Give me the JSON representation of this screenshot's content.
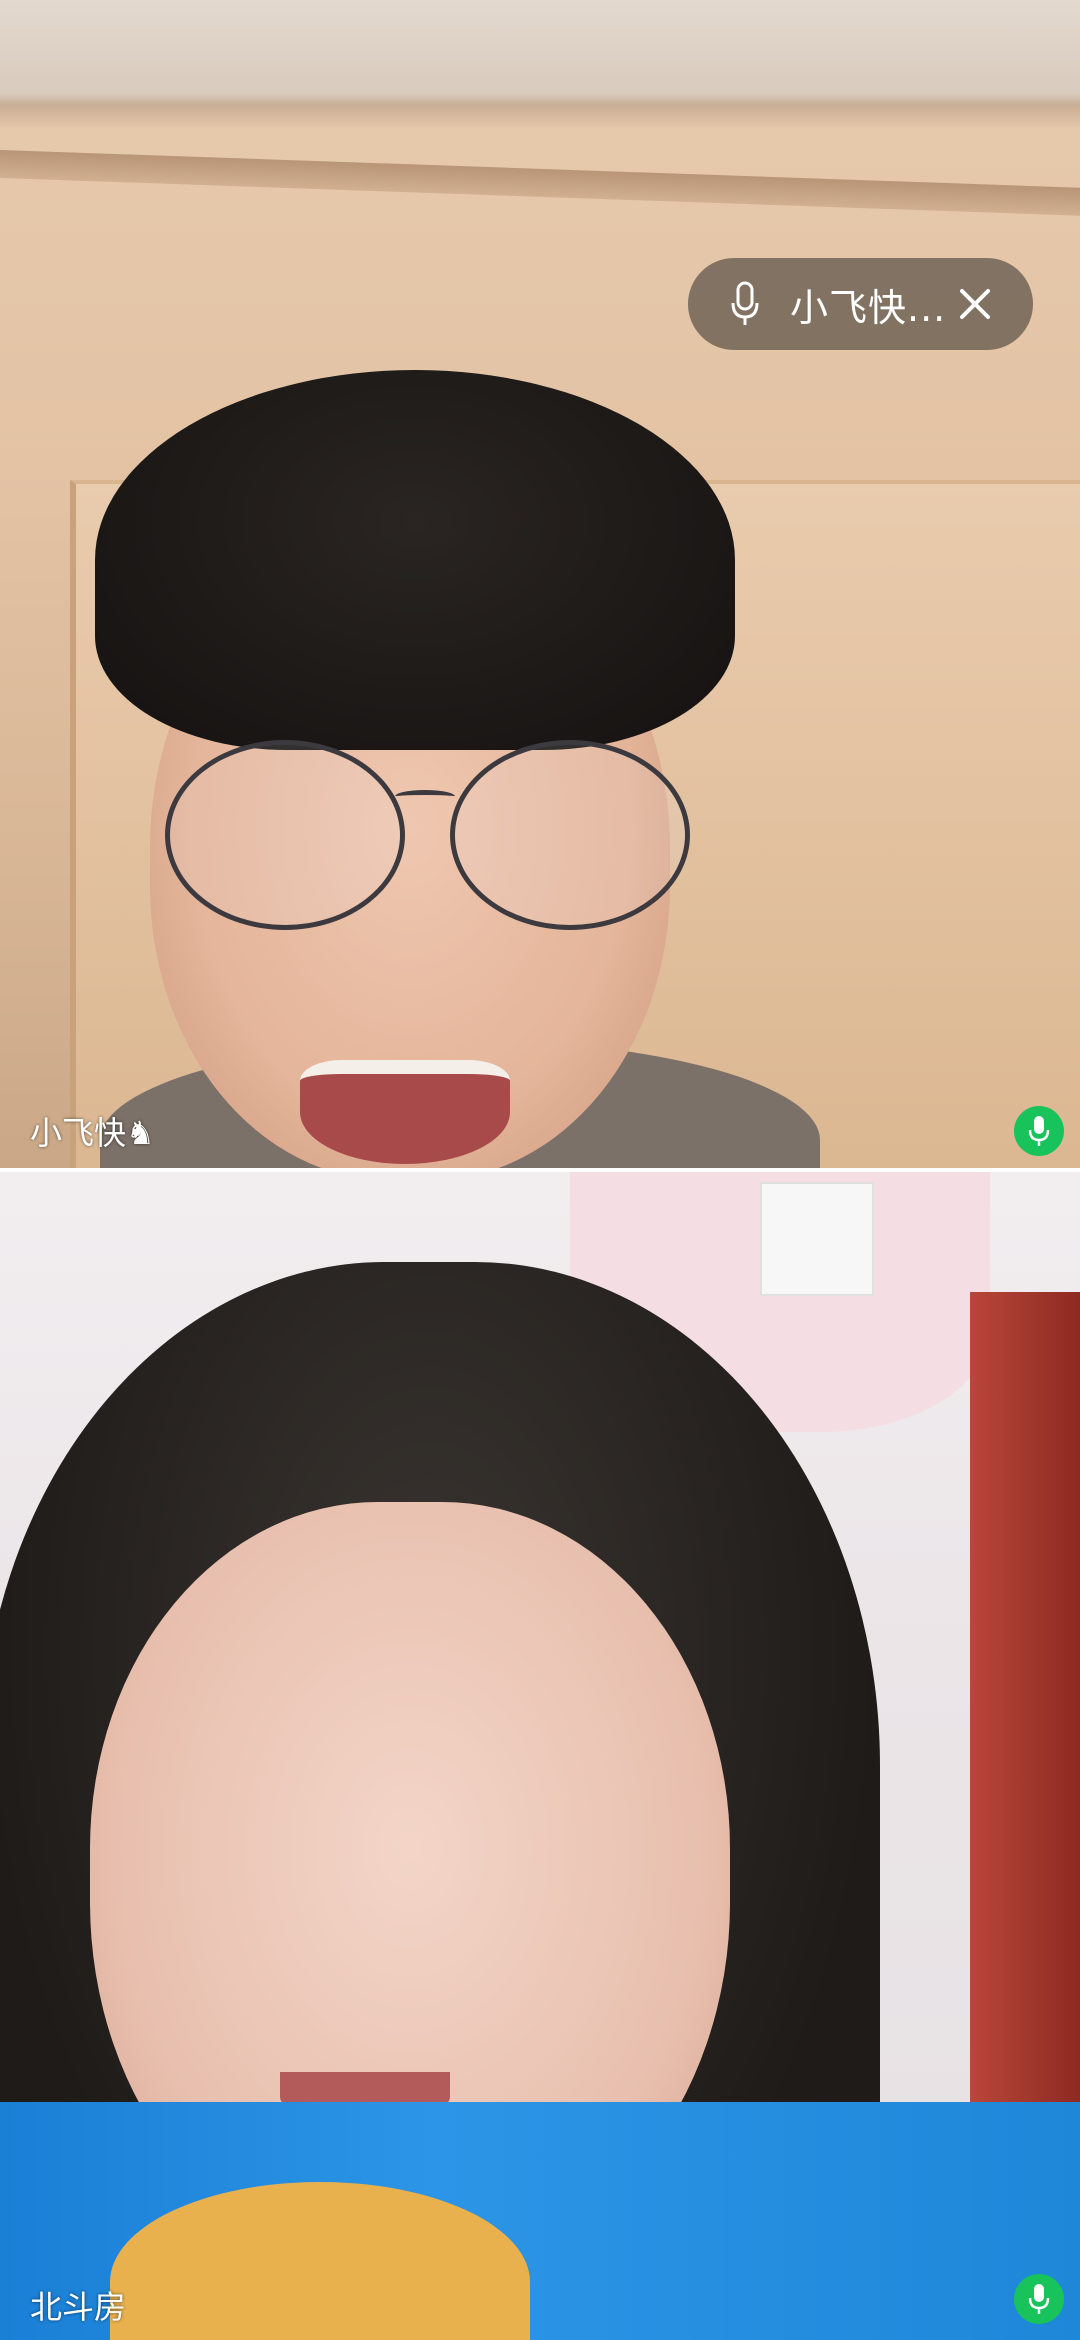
{
  "call": {
    "floating_pill": {
      "name": "小飞快...",
      "mic_icon": "microphone-icon",
      "close_icon": "close-icon"
    },
    "participants": [
      {
        "name": "小飞快♞",
        "mic_icon": "microphone-icon",
        "mic_color": "#17c35a"
      },
      {
        "name": "北斗房",
        "mic_icon": "microphone-icon",
        "mic_color": "#17c35a"
      }
    ]
  }
}
